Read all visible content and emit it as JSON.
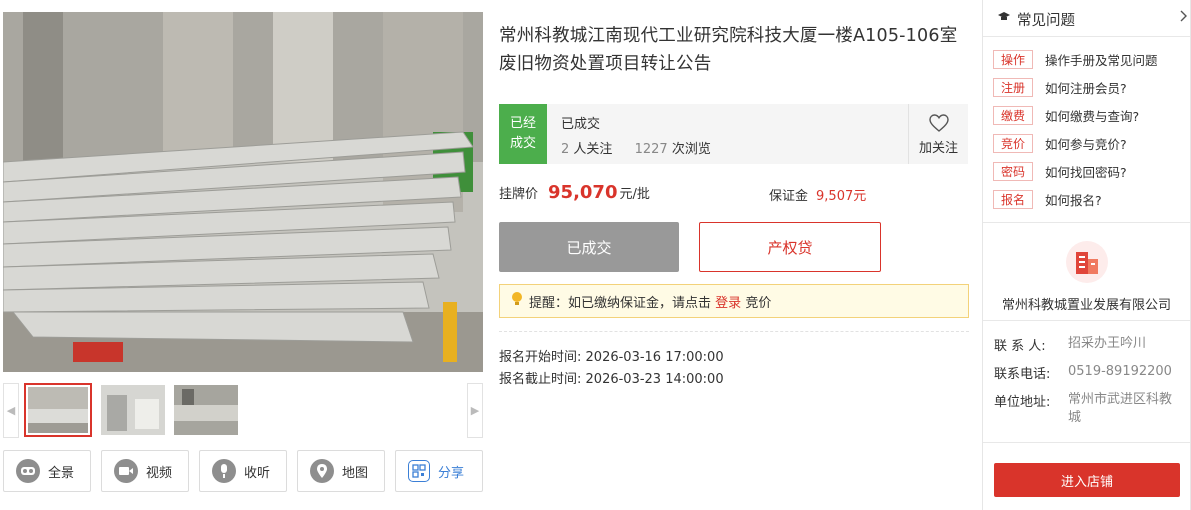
{
  "title": "常州科教城江南现代工业研究院科技大厦一楼A105-106室废旧物资处置项目转让公告",
  "status": {
    "badge_line1": "已经",
    "badge_line2": "成交",
    "text": "已成交",
    "followers": "2",
    "followers_label": "人关注",
    "views": "1227",
    "views_label": "次浏览",
    "follow_button": "加关注"
  },
  "price": {
    "label": "挂牌价",
    "value": "95,070",
    "unit": "元/批",
    "deposit_label": "保证金",
    "deposit_value": "9,507元"
  },
  "buttons": {
    "done": "已成交",
    "loan": "产权贷"
  },
  "tip": {
    "prefix": "提醒：如已缴纳保证金，请点击",
    "link": "登录",
    "suffix": "竞价"
  },
  "times": {
    "start_label": "报名开始时间:",
    "start_value": "2026-03-16 17:00:00",
    "end_label": "报名截止时间:",
    "end_value": "2026-03-23 14:00:00"
  },
  "tools": [
    {
      "label": "全景",
      "icon": "vr-glasses-icon"
    },
    {
      "label": "视频",
      "icon": "video-camera-icon"
    },
    {
      "label": "收听",
      "icon": "microphone-icon"
    },
    {
      "label": "地图",
      "icon": "map-pin-icon"
    },
    {
      "label": "分享",
      "icon": "share-icon"
    }
  ],
  "faq": {
    "heading": "常见问题",
    "items": [
      {
        "tag": "操作",
        "text": "操作手册及常见问题"
      },
      {
        "tag": "注册",
        "text": "如何注册会员?"
      },
      {
        "tag": "缴费",
        "text": "如何缴费与查询?"
      },
      {
        "tag": "竞价",
        "text": "如何参与竞价?"
      },
      {
        "tag": "密码",
        "text": "如何找回密码?"
      },
      {
        "tag": "报名",
        "text": "如何报名?"
      }
    ]
  },
  "company": {
    "name": "常州科教城置业发展有限公司",
    "contact_label": "联 系 人:",
    "contact_value": "招采办王吟川",
    "phone_label": "联系电话:",
    "phone_value": "0519-89192200",
    "address_label": "单位地址:",
    "address_value": "常州市武进区科教城",
    "enter_button": "进入店铺"
  },
  "colors": {
    "accent_red": "#d9342b",
    "success_green": "#4cae4c",
    "tip_yellow_bg": "#fffbe5",
    "disabled_gray": "#999999"
  }
}
